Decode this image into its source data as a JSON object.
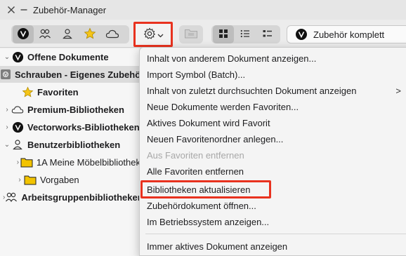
{
  "window": {
    "title": "Zubehör-Manager"
  },
  "toolbar": {
    "search_value": "Zubehör komplett"
  },
  "tree": {
    "rows": [
      {
        "label": "Offene Dokumente",
        "bold": true
      },
      {
        "label": "Schrauben - Eigenes Zubehör",
        "bold": true
      },
      {
        "label": "Favoriten",
        "bold": true
      },
      {
        "label": "Premium-Bibliotheken",
        "bold": true
      },
      {
        "label": "Vectorworks-Bibliotheken",
        "bold": true
      },
      {
        "label": "Benutzerbibliotheken",
        "bold": true
      },
      {
        "label": "1A Meine Möbelbibliothek",
        "bold": false
      },
      {
        "label": "Vorgaben",
        "bold": false
      },
      {
        "label": "Arbeitsgruppenbibliotheken",
        "bold": true
      }
    ]
  },
  "menu": {
    "items": [
      {
        "label": "Inhalt von anderem Dokument anzeigen...",
        "disabled": false
      },
      {
        "label": "Import Symbol (Batch)...",
        "disabled": false
      },
      {
        "label": "Inhalt von zuletzt durchsuchten Dokument anzeigen",
        "disabled": false,
        "submenu": ">"
      },
      {
        "label": "Neue Dokumente werden Favoriten...",
        "disabled": false
      },
      {
        "label": "Aktives Dokument wird Favorit",
        "disabled": false
      },
      {
        "label": "Neuen Favoritenordner anlegen...",
        "disabled": false
      },
      {
        "label": "Aus Favoriten entfernen",
        "disabled": true
      },
      {
        "label": "Alle Favoriten entfernen",
        "disabled": false
      },
      {
        "label": "Bibliotheken aktualisieren",
        "disabled": false
      },
      {
        "label": "Zubehördokument öffnen...",
        "disabled": false
      },
      {
        "label": "Im Betriebssystem anzeigen...",
        "disabled": false
      },
      {
        "label": "Immer aktives Dokument anzeigen",
        "disabled": false
      }
    ]
  },
  "colors": {
    "highlight": "#e8321f",
    "folder": "#f2c300",
    "star": "#f5c518"
  }
}
